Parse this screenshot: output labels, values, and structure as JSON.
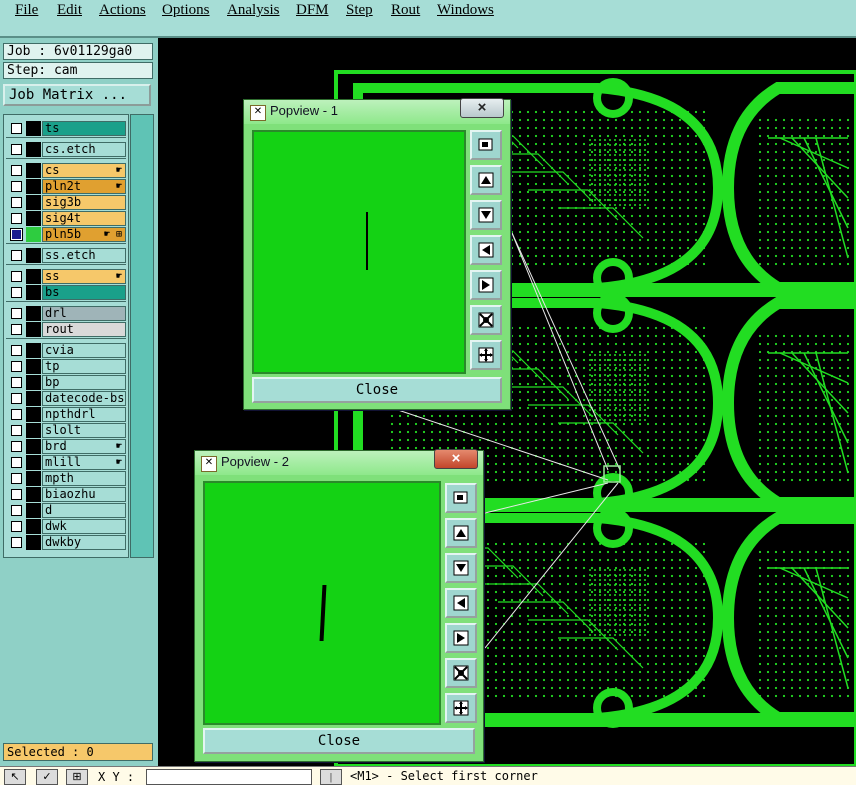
{
  "menu": [
    "File",
    "Edit",
    "Actions",
    "Options",
    "Analysis",
    "DFM",
    "Step",
    "Rout",
    "Windows"
  ],
  "job_label": "Job : 6v01129ga0",
  "step_label": "Step: cam",
  "job_matrix_label": "Job Matrix ...",
  "layers": [
    {
      "name": "ts",
      "color": "#1aa08a",
      "checked": false,
      "flag": ""
    },
    {
      "name": "cs.etch",
      "color": "#a6ddd6",
      "checked": false,
      "flag": ""
    },
    {
      "name": "cs",
      "color": "#f6c86a",
      "checked": false,
      "flag": "☛"
    },
    {
      "name": "pln2t",
      "color": "#e0a030",
      "checked": false,
      "flag": "☛"
    },
    {
      "name": "sig3b",
      "color": "#f6c86a",
      "checked": false,
      "flag": ""
    },
    {
      "name": "sig4t",
      "color": "#f6c86a",
      "checked": false,
      "flag": ""
    },
    {
      "name": "pln5b",
      "color": "#e0a030",
      "checked": true,
      "flag": "☛ ⊞"
    },
    {
      "name": "ss.etch",
      "color": "#a6ddd6",
      "checked": false,
      "flag": ""
    },
    {
      "name": "ss",
      "color": "#f6c86a",
      "checked": false,
      "flag": "☛"
    },
    {
      "name": "bs",
      "color": "#1aa08a",
      "checked": false,
      "flag": ""
    },
    {
      "name": "drl",
      "color": "#9fb4b8",
      "checked": false,
      "flag": ""
    },
    {
      "name": "rout",
      "color": "#d9d9d9",
      "checked": false,
      "flag": ""
    },
    {
      "name": "cvia",
      "color": "#a6ddd6",
      "checked": false,
      "flag": ""
    },
    {
      "name": "tp",
      "color": "#a6ddd6",
      "checked": false,
      "flag": ""
    },
    {
      "name": "bp",
      "color": "#a6ddd6",
      "checked": false,
      "flag": ""
    },
    {
      "name": "datecode-bs",
      "color": "#a6ddd6",
      "checked": false,
      "flag": ""
    },
    {
      "name": "npthdrl",
      "color": "#a6ddd6",
      "checked": false,
      "flag": ""
    },
    {
      "name": "slolt",
      "color": "#a6ddd6",
      "checked": false,
      "flag": ""
    },
    {
      "name": "brd",
      "color": "#a6ddd6",
      "checked": false,
      "flag": "☛"
    },
    {
      "name": "mlill",
      "color": "#a6ddd6",
      "checked": false,
      "flag": "☛"
    },
    {
      "name": "mpth",
      "color": "#a6ddd6",
      "checked": false,
      "flag": ""
    },
    {
      "name": "biaozhu",
      "color": "#a6ddd6",
      "checked": false,
      "flag": ""
    },
    {
      "name": "d",
      "color": "#a6ddd6",
      "checked": false,
      "flag": ""
    },
    {
      "name": "dwk",
      "color": "#a6ddd6",
      "checked": false,
      "flag": ""
    },
    {
      "name": "dwkby",
      "color": "#a6ddd6",
      "checked": false,
      "flag": ""
    }
  ],
  "selected_label": "Selected : 0",
  "bottom": {
    "xy_label": "X Y :",
    "status": "<M1> - Select first corner"
  },
  "popview1": {
    "title": "Popview - 1",
    "close_label": "Close",
    "close_x": "×"
  },
  "popview2": {
    "title": "Popview - 2",
    "close_label": "Close",
    "close_x": "×"
  },
  "colors": {
    "pcb": "#22dd22",
    "background": "#000000",
    "panel": "#8fd0c6"
  }
}
